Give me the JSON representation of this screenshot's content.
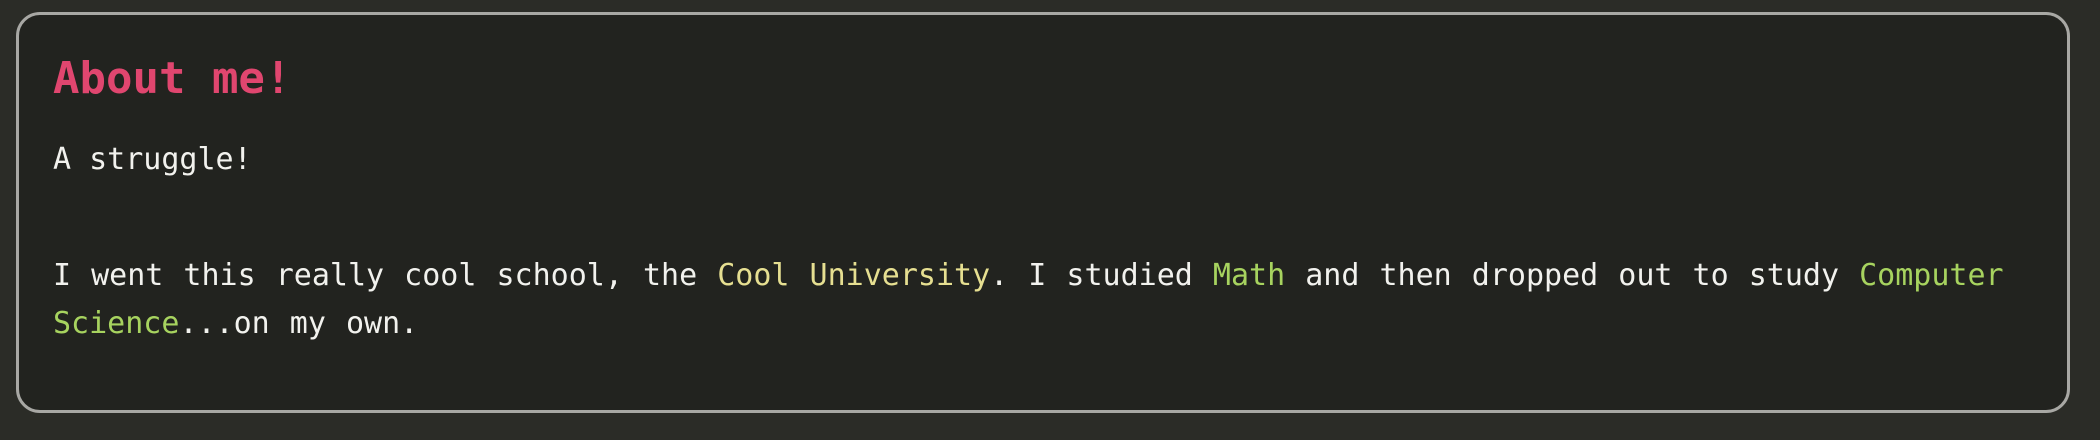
{
  "section": {
    "title": "About me!",
    "subtitle": "A struggle!",
    "paragraph": {
      "text1": "I went this really cool school, the ",
      "school": "Cool University",
      "text2": ". I studied ",
      "subject": "Math",
      "text3": " and then dropped out to study ",
      "new_subject": "Computer Science",
      "text4": "...on my own."
    }
  },
  "colors": {
    "title": "#e0466f",
    "school_highlight": "#e6df91",
    "subject_highlight": "#a7d35f",
    "text": "#f2f2ee",
    "background": "#22231f",
    "border": "#a8a8a4"
  }
}
